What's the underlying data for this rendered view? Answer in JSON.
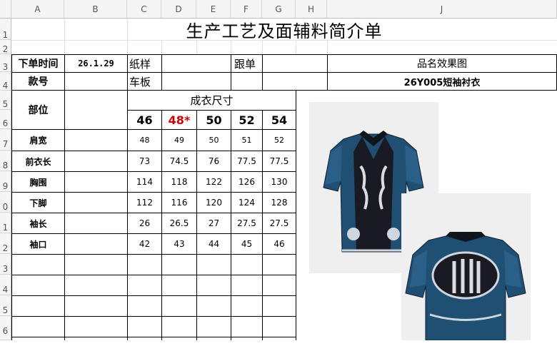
{
  "columns": [
    "A",
    "B",
    "C",
    "D",
    "E",
    "F",
    "G",
    "H",
    "J"
  ],
  "rows": [
    "1",
    "2",
    "3",
    "4",
    "5",
    "6",
    "7",
    "8",
    "9",
    "0",
    "1",
    "2",
    "3",
    "4",
    "5",
    "6"
  ],
  "title": "生产工艺及面辅料简介单",
  "header": {
    "order_time_label": "下单时间",
    "order_time_value": "26.1.29",
    "paper_sample_label": "纸样",
    "follow_label": "跟单",
    "product_image_label": "品名效果图",
    "style_no_label": "款号",
    "sewing_board_label": "车板",
    "product_name": "26Y005短袖衬衣"
  },
  "size_table": {
    "part_label": "部位",
    "size_group_label": "成衣尺寸",
    "sizes": [
      "46",
      "48*",
      "50",
      "52",
      "54"
    ],
    "highlight_color": "#d00000",
    "rows": [
      {
        "part": "肩宽",
        "values": [
          "48",
          "49",
          "50",
          "51",
          "52"
        ]
      },
      {
        "part": "前衣长",
        "values": [
          "73",
          "74.5",
          "76",
          "77.5",
          "77.5"
        ]
      },
      {
        "part": "胸围",
        "values": [
          "114",
          "118",
          "122",
          "126",
          "130"
        ]
      },
      {
        "part": "下脚",
        "values": [
          "112",
          "116",
          "120",
          "124",
          "128"
        ]
      },
      {
        "part": "袖长",
        "values": [
          "26",
          "26.5",
          "27",
          "27.5",
          "27.5"
        ]
      },
      {
        "part": "袖口",
        "values": [
          "42",
          "43",
          "44",
          "45",
          "46"
        ]
      }
    ]
  },
  "colors": {
    "shirt_blue": "#1f4f73",
    "shirt_dark": "#1a1a22",
    "image_bg": "#efefef"
  }
}
